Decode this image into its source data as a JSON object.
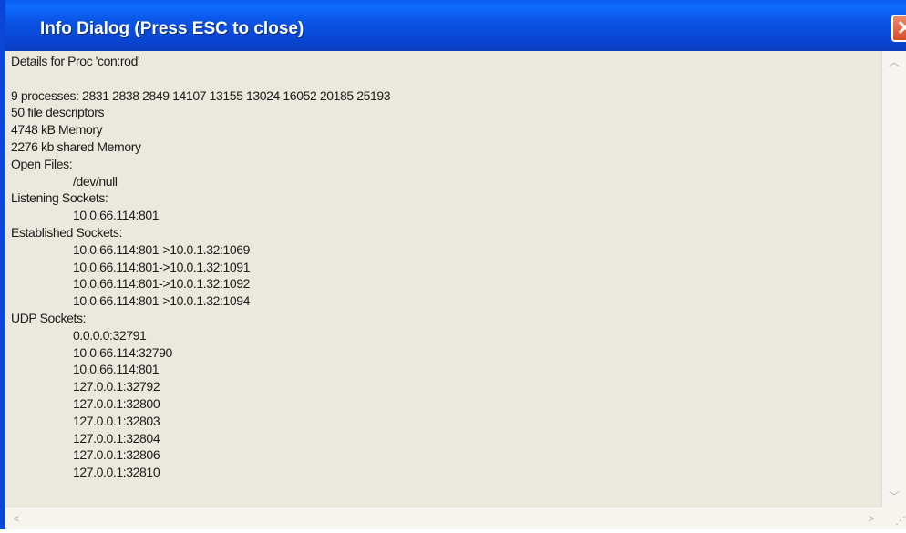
{
  "window": {
    "title": "Info Dialog (Press ESC to close)",
    "close_symbol": "✕"
  },
  "content": {
    "lines": [
      "Details for Proc 'con:rod'",
      "",
      "9 processes: 2831 2838 2849 14107 13155 13024 16052 20185 25193",
      "50 file descriptors",
      "4748 kB Memory",
      "2276 kb shared Memory",
      "Open Files:",
      "/dev/null",
      "Listening Sockets:",
      "10.0.66.114:801",
      "Established Sockets:",
      "10.0.66.114:801->10.0.1.32:1069",
      "10.0.66.114:801->10.0.1.32:1091",
      "10.0.66.114:801->10.0.1.32:1092",
      "10.0.66.114:801->10.0.1.32:1094",
      "UDP Sockets:",
      "0.0.0.0:32791",
      "10.0.66.114:32790",
      "10.0.66.114:801",
      "127.0.0.1:32792",
      "127.0.0.1:32800",
      "127.0.0.1:32803",
      "127.0.0.1:32804",
      "127.0.0.1:32806",
      "127.0.0.1:32810"
    ]
  },
  "scrollbars": {
    "up_arrow": "︿",
    "down_arrow": "﹀",
    "left_arrow": "<",
    "right_arrow": ">",
    "grip": "⋰"
  }
}
